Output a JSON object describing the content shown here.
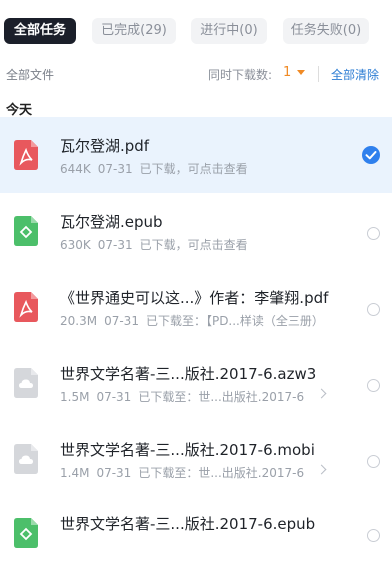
{
  "tabs": [
    {
      "label": "全部任务",
      "active": true
    },
    {
      "label": "已完成(29)",
      "active": false
    },
    {
      "label": "进行中(0)",
      "active": false
    },
    {
      "label": "任务失败(0)",
      "active": false
    }
  ],
  "toolbar": {
    "all_files": "全部文件",
    "concurrent_label": "同时下载数:",
    "concurrent_value": "1",
    "clear_all": "全部清除"
  },
  "section_title": "今天",
  "files": [
    {
      "name": "瓦尔登湖.pdf",
      "size": "644K",
      "date": "07-31",
      "status": "已下载，可点击查看",
      "icon": "pdf-icon",
      "selected": true
    },
    {
      "name": "瓦尔登湖.epub",
      "size": "630K",
      "date": "07-31",
      "status": "已下载，可点击查看",
      "icon": "epub-icon",
      "selected": false
    },
    {
      "name": "《世界通史可以这...》作者：李肇翔.pdf",
      "size": "20.3M",
      "date": "07-31",
      "status": "已下载至：【PD...样读（全三册）",
      "icon": "pdf-icon",
      "selected": false
    },
    {
      "name": "世界文学名著-三...版社.2017-6.azw3",
      "size": "1.5M",
      "date": "07-31",
      "status": "已下载至：世...出版社.2017-6",
      "icon": "cloud-file-icon",
      "selected": false
    },
    {
      "name": "世界文学名著-三...版社.2017-6.mobi",
      "size": "1.4M",
      "date": "07-31",
      "status": "已下载至：世...出版社.2017-6",
      "icon": "cloud-file-icon",
      "selected": false
    },
    {
      "name": "世界文学名著-三...版社.2017-6.epub",
      "size": "",
      "date": "",
      "status": "",
      "icon": "epub-icon",
      "selected": false
    }
  ],
  "colors": {
    "accent": "#2f80ed",
    "pdf": "#e8585d",
    "epub": "#4cbf6a",
    "generic": "#d5d7db",
    "highlight": "#f08a24"
  }
}
